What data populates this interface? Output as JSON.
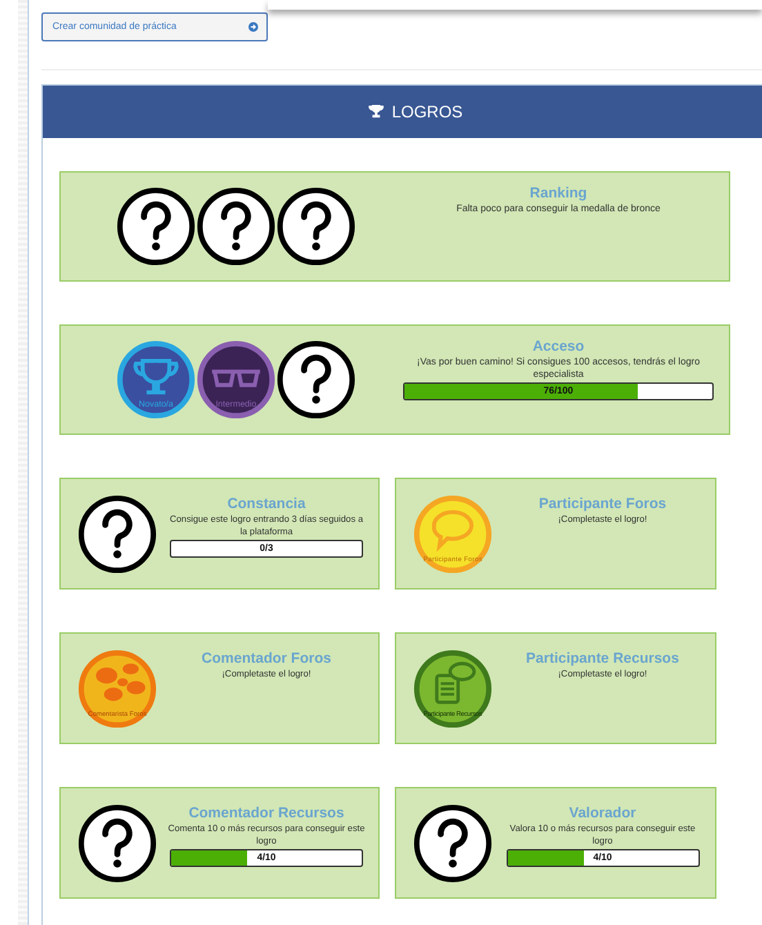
{
  "button": {
    "label": "Crear comunidad de práctica"
  },
  "panel": {
    "title": "LOGROS"
  },
  "achievements": [
    {
      "kind": "wide",
      "title": "Ranking",
      "description": "Falta poco para conseguir la medalla de bronce",
      "badges": [
        {
          "kind": "unknown"
        },
        {
          "kind": "unknown"
        },
        {
          "kind": "unknown"
        }
      ]
    },
    {
      "kind": "wide",
      "title": "Acceso",
      "description": "¡Vas por buen camino! Si consigues 100 accesos, tendrás el logro especialista",
      "badges": [
        {
          "kind": "trophy",
          "label": "Novato/a"
        },
        {
          "kind": "glasses",
          "label": "Intermedio"
        },
        {
          "kind": "unknown"
        }
      ],
      "progress": {
        "level": 0.76,
        "reading": "76/100"
      }
    },
    {
      "kind": "half",
      "title": "Constancia",
      "description": "Consigue este logro entrando 3 días seguidos a la plataforma",
      "badges": [
        {
          "kind": "unknown"
        }
      ],
      "progress": {
        "reading": "0/3"
      }
    },
    {
      "kind": "half",
      "title": "Participante Foros",
      "description": "¡Completaste el logro!",
      "badges": [
        {
          "kind": "speech",
          "label": "Participante Foros"
        }
      ]
    },
    {
      "kind": "half",
      "title": "Comentador Foros",
      "description": "¡Completaste el logro!",
      "badges": [
        {
          "kind": "bubbles",
          "label": "Comentarista Foros"
        }
      ]
    },
    {
      "kind": "half",
      "title": "Participante Recursos",
      "description": "¡Completaste el logro!",
      "badges": [
        {
          "kind": "document",
          "label": "Participante Recursos"
        }
      ]
    },
    {
      "kind": "half",
      "title": "Comentador Recursos",
      "description": "Comenta 10 o más recursos para conseguir este logro",
      "badges": [
        {
          "kind": "unknown"
        }
      ],
      "progress": {
        "level": 0.4,
        "reading": "4/10"
      }
    },
    {
      "kind": "half",
      "title": "Valorador",
      "description": "Valora 10 o más recursos para conseguir este logro",
      "badges": [
        {
          "kind": "unknown"
        }
      ],
      "progress": {
        "level": 0.4,
        "reading": "4/10"
      }
    }
  ]
}
